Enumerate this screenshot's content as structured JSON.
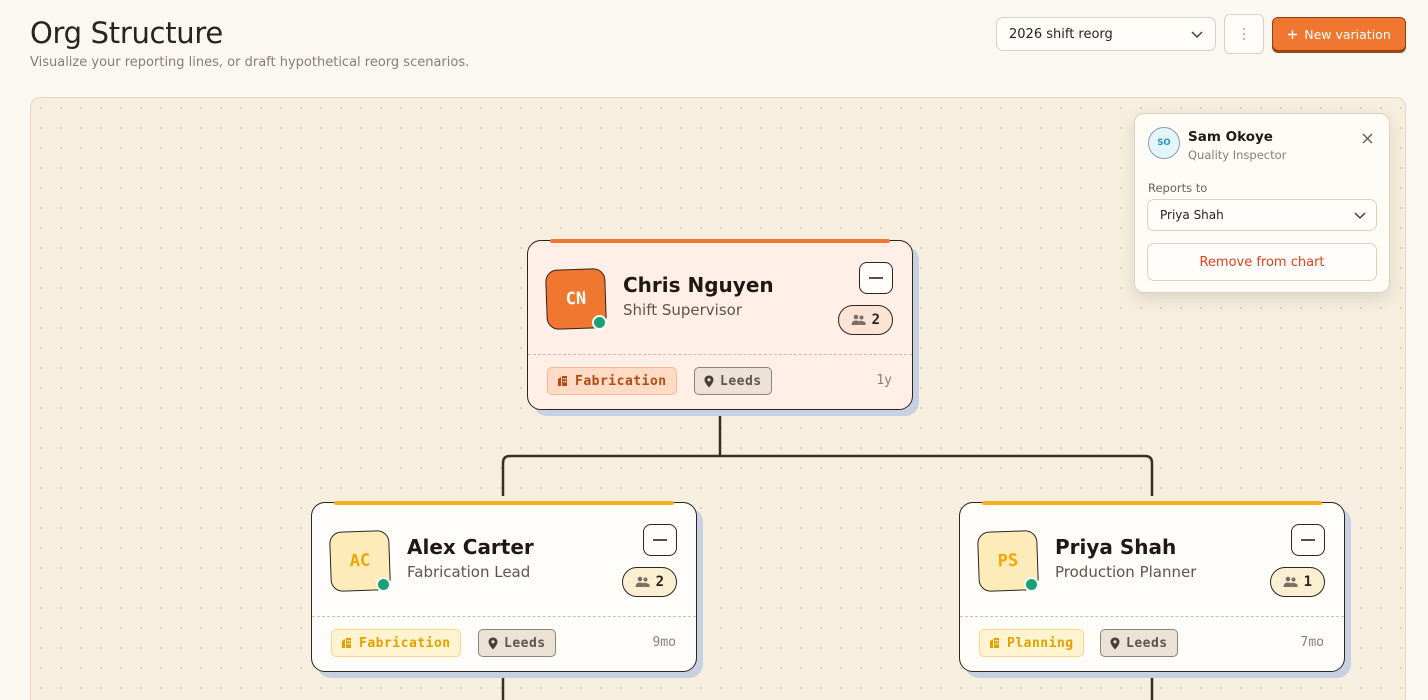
{
  "header": {
    "title": "Org Structure",
    "subtitle": "Visualize your reporting lines, or draft hypothetical reorg scenarios."
  },
  "toolbar": {
    "scenario_selected": "2026 shift reorg",
    "more_icon": "vertical-dots-icon",
    "new_variation_label": "New variation",
    "new_variation_icon": "plus-icon"
  },
  "chart": {
    "root": {
      "initials": "CN",
      "name": "Chris Nguyen",
      "role": "Shift Supervisor",
      "reports": "2",
      "department": "Fabrication",
      "location": "Leeds",
      "tenure": "1y",
      "accent": "#f0772f"
    },
    "children": [
      {
        "initials": "AC",
        "name": "Alex Carter",
        "role": "Fabrication Lead",
        "reports": "2",
        "department": "Fabrication",
        "location": "Leeds",
        "tenure": "9mo",
        "accent": "#f6ae1a"
      },
      {
        "initials": "PS",
        "name": "Priya Shah",
        "role": "Production Planner",
        "reports": "1",
        "department": "Planning",
        "location": "Leeds",
        "tenure": "7mo",
        "accent": "#f6ae1a"
      }
    ]
  },
  "popover": {
    "initials": "SO",
    "name": "Sam Okoye",
    "role": "Quality Inspector",
    "reports_to_label": "Reports to",
    "reports_to_value": "Priya Shah",
    "remove_label": "Remove from chart"
  },
  "colors": {
    "primary": "#f0772f",
    "status_online": "#18a174",
    "danger": "#e0401f"
  }
}
